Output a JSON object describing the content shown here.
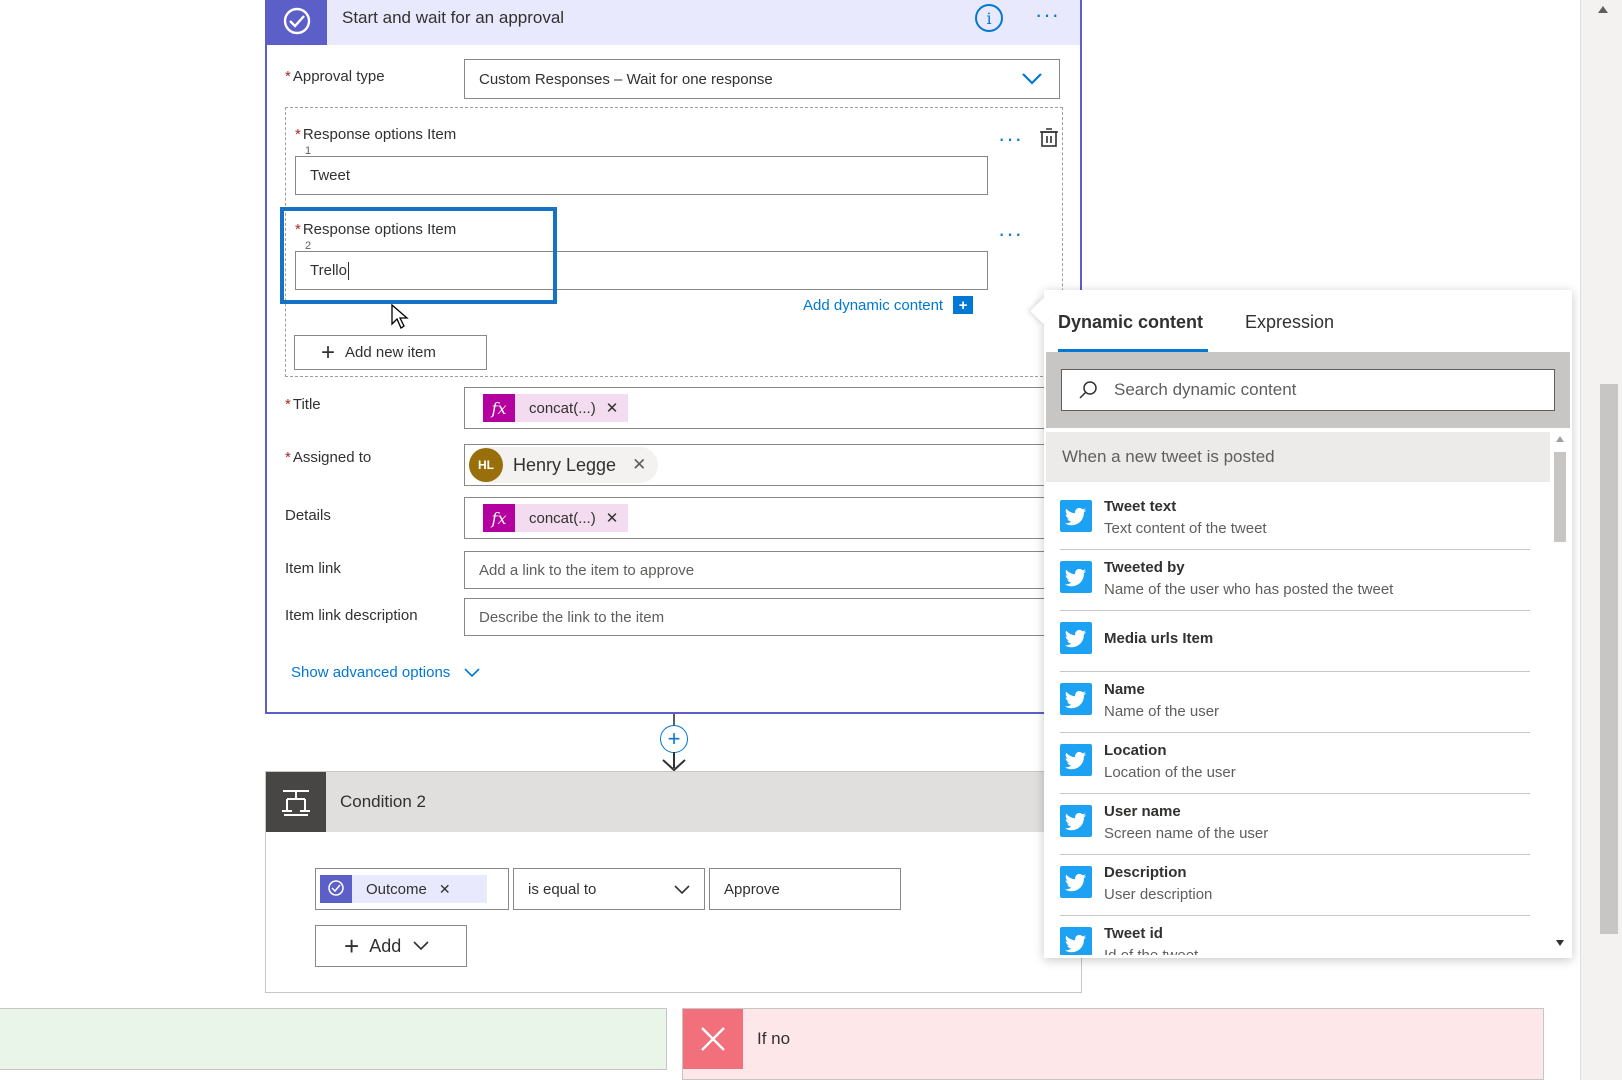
{
  "approval": {
    "title": "Start and wait for an approval",
    "approval_type_label": "Approval type",
    "approval_type_value": "Custom Responses – Wait for one response",
    "response_label": "Response options Item",
    "response_1_index": "1",
    "response_1_value": "Tweet",
    "response_2_index": "2",
    "response_2_value": "Trello",
    "add_dynamic": "Add dynamic content",
    "add_new_item": "Add new item",
    "title_label": "Title",
    "title_token": "concat(...)",
    "assigned_label": "Assigned to",
    "assigned_initials": "HL",
    "assigned_name": "Henry Legge",
    "details_label": "Details",
    "details_token": "concat(...)",
    "item_link_label": "Item link",
    "item_link_placeholder": "Add a link to the item to approve",
    "item_link_desc_label": "Item link description",
    "item_link_desc_placeholder": "Describe the link to the item",
    "show_advanced": "Show advanced options"
  },
  "condition": {
    "title": "Condition 2",
    "outcome_token": "Outcome",
    "operator": "is equal to",
    "value": "Approve",
    "add_label": "Add"
  },
  "if_no": {
    "label": "If no"
  },
  "dynamic_panel": {
    "tab_dynamic": "Dynamic content",
    "tab_expression": "Expression",
    "search_placeholder": "Search dynamic content",
    "group_header": "When a new tweet is posted",
    "items": [
      {
        "title": "Tweet text",
        "sub": "Text content of the tweet"
      },
      {
        "title": "Tweeted by",
        "sub": "Name of the user who has posted the tweet"
      },
      {
        "title": "Media urls Item",
        "sub": ""
      },
      {
        "title": "Name",
        "sub": "Name of the user"
      },
      {
        "title": "Location",
        "sub": "Location of the user"
      },
      {
        "title": "User name",
        "sub": "Screen name of the user"
      },
      {
        "title": "Description",
        "sub": "User description"
      },
      {
        "title": "Tweet id",
        "sub": "Id of the tweet"
      }
    ]
  },
  "colors": {
    "accent": "#0078d4",
    "approval_header": "#e8e9fc",
    "approval_icon": "#5b5fc7",
    "fx_token": "#b4009e",
    "twitter": "#1da1f2",
    "if_no_bg": "#fde7e9",
    "if_no_icon": "#f1707b"
  }
}
